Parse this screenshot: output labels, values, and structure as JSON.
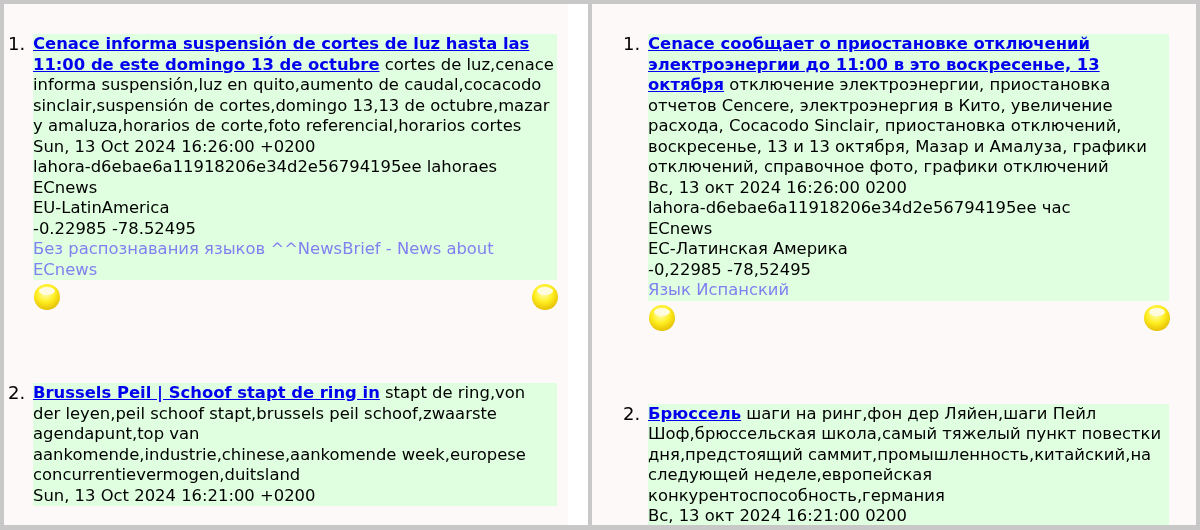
{
  "panes": [
    {
      "items": [
        {
          "number": "1.",
          "title": "Cenace informa suspensión de cortes de luz hasta las 11:00 de este domingo 13 de octubre",
          "keywords": "cortes de luz,cenace informa suspensión,luz en quito,aumento de caudal,cocacodo sinclair,suspensión de cortes,domingo 13,13 de octubre,mazar y amaluza,horarios de corte,foto referencial,horarios cortes",
          "lines": [
            "Sun, 13 Oct 2024 16:26:00 +0200",
            "lahora-d6ebae6a11918206e34d2e56794195ee lahoraes",
            "ECnews",
            "EU-LatinAmerica",
            "-0.22985 -78.52495"
          ],
          "note": "Без распознавания языков ^^NewsBrief - News about ECnews"
        },
        {
          "number": "2.",
          "title": "Brussels Peil | Schoof stapt de ring in",
          "keywords": "stapt de ring,von der leyen,peil schoof stapt,brussels peil schoof,zwaarste agendapunt,top van aankomende,industrie,chinese,aankomende week,europese concurrentievermogen,duitsland",
          "lines": [
            "Sun, 13 Oct 2024 16:21:00 +0200"
          ]
        }
      ]
    },
    {
      "items": [
        {
          "number": "1.",
          "title": "Cenace сообщает о приостановке отключений электроэнергии до 11:00 в это воскресенье, 13 октября",
          "keywords": "отключение электроэнергии, приостановка отчетов Cencere, электроэнергия в Кито, увеличение расхода, Cocacodo Sinclair, приостановка отключений, воскресенье, 13 и 13 октября, Мазар и Амалуза, графики отключений, справочное фото, графики отключений",
          "lines": [
            "Вс, 13 окт 2024 16:26:00 0200",
            "lahora-d6ebae6a11918206e34d2e56794195ee час",
            "ECnews",
            "ЕС-Латинская Америка",
            "-0,22985 -78,52495"
          ],
          "note": "Язык Испанский"
        },
        {
          "number": "2.",
          "title": "Брюссель",
          "keywords": "шаги на ринг,фон дер Ляйен,шаги Пейл Шоф,брюссельская школа,самый тяжелый пункт повестки дня,предстоящий саммит,промышленность,китайский,на следующей неделе,европейская конкурентоспособность,германия",
          "lines": [
            "Вс, 13 окт 2024 16:21:00 0200"
          ]
        }
      ]
    }
  ]
}
